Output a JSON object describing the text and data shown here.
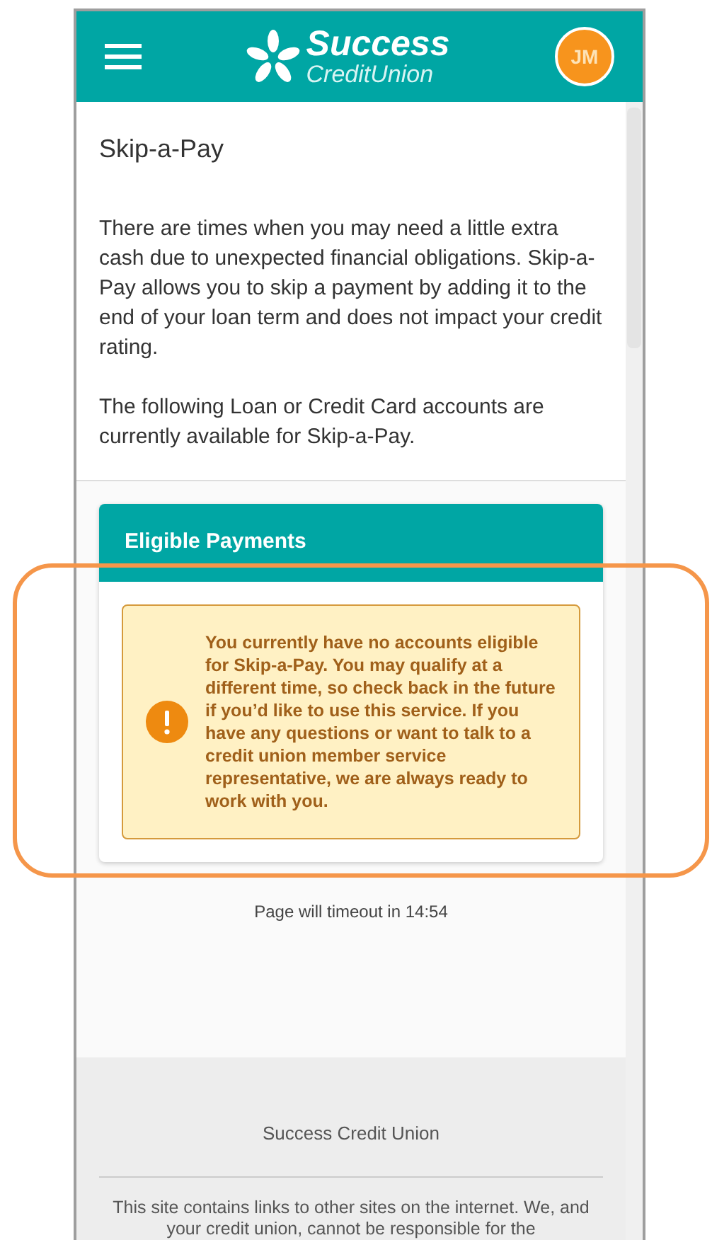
{
  "header": {
    "logo_title": "Success",
    "logo_subtitle": "CreditUnion",
    "avatar_initials": "JM"
  },
  "page_title": "Skip-a-Pay",
  "intro_paragraphs": [
    "There are times when you may need a little extra cash due to unexpected financial obligations. Skip-a-Pay allows you to skip a payment by adding it to the end of your loan term and does not impact your credit rating.",
    "The following Loan or Credit Card accounts are currently available for Skip-a-Pay."
  ],
  "card": {
    "title": "Eligible Payments",
    "alert": {
      "kind": "warning",
      "message": "You currently have no accounts eligible for Skip-a-Pay. You may qualify at a different time, so check back in the future if you’d like to use this service. If you have any questions or want to talk to a credit union member service representative, we are always ready to work with you."
    }
  },
  "timeout": "Page will timeout in 14:54",
  "footer": {
    "name": "Success Credit Union",
    "disclaimer": "This site contains links to other sites on the internet. We, and your credit union, cannot be responsible for the"
  }
}
